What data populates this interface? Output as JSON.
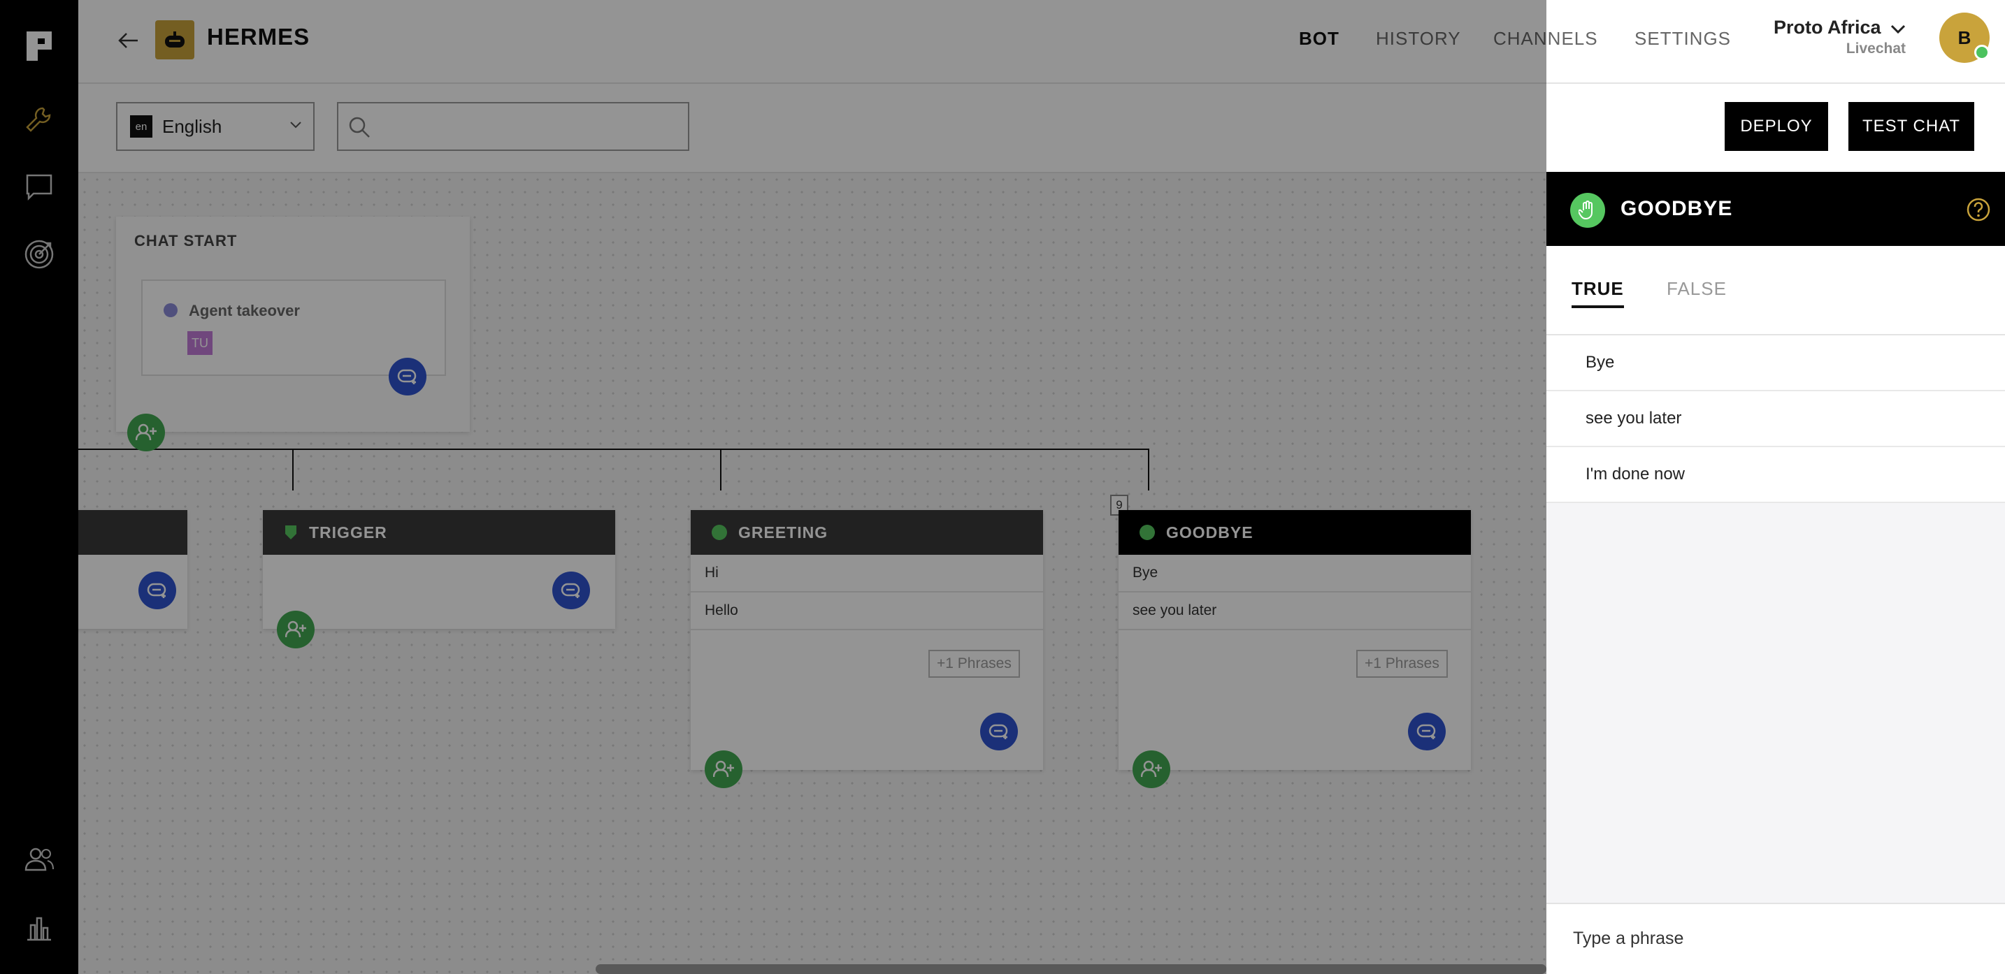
{
  "header": {
    "bot_name": "HERMES",
    "nav": [
      "BOT",
      "HISTORY",
      "CHANNELS",
      "SETTINGS"
    ],
    "active_nav": "BOT",
    "org_name": "Proto Africa",
    "org_sub": "Livechat",
    "avatar_initial": "B"
  },
  "toolbar": {
    "lang_code": "en",
    "lang_label": "English",
    "search_placeholder": "",
    "deploy_label": "DEPLOY",
    "test_chat_label": "TEST CHAT"
  },
  "canvas": {
    "chat_start": {
      "title": "CHAT START",
      "inner_label": "Agent takeover",
      "tag": "TU"
    },
    "trigger": {
      "title": "TRIGGER"
    },
    "greeting": {
      "title": "GREETING",
      "phrases": [
        "Hi",
        "Hello"
      ],
      "more": "+1 Phrases"
    },
    "goodbye": {
      "title": "GOODBYE",
      "phrases": [
        "Bye",
        "see you later"
      ],
      "more": "+1 Phrases",
      "badge": "9"
    }
  },
  "panel": {
    "title": "GOODBYE",
    "tab_true": "TRUE",
    "tab_false": "FALSE",
    "phrases": [
      "Bye",
      "see you later",
      "I'm done now"
    ],
    "input_placeholder": "Type a phrase"
  },
  "colors": {
    "accent_gold": "#c9a33b",
    "primary_blue": "#2f54cf",
    "add_green": "#43a852",
    "goodbye_green": "#56c760"
  }
}
